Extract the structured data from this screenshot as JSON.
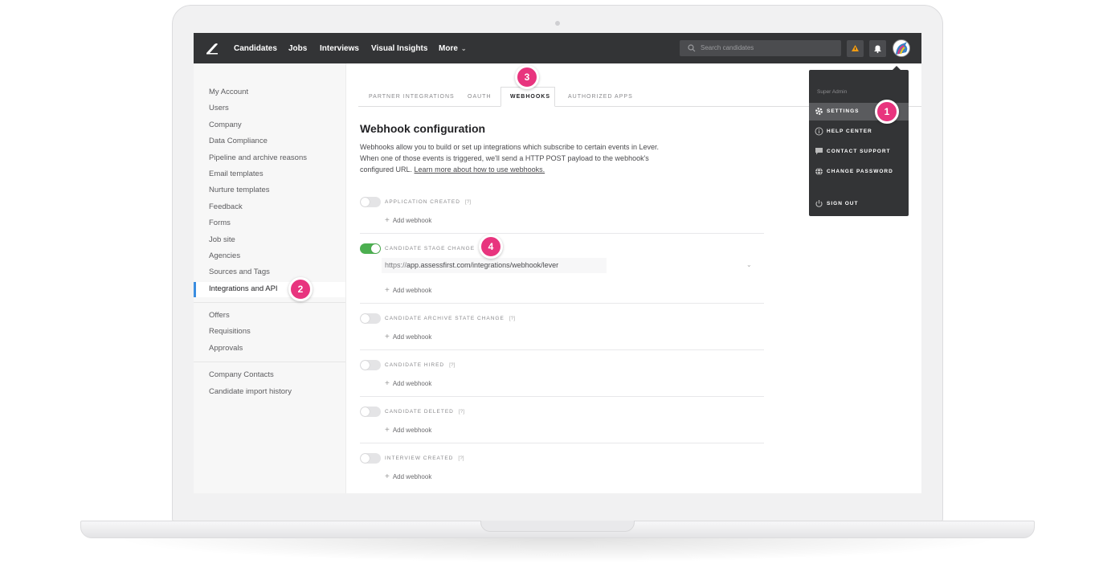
{
  "topbar": {
    "nav": [
      "Candidates",
      "Jobs",
      "Interviews",
      "Visual Insights",
      "More"
    ],
    "search_placeholder": "Search candidates"
  },
  "sidebar": {
    "group1": [
      "My Account",
      "Users",
      "Company",
      "Data Compliance",
      "Pipeline and archive reasons",
      "Email templates",
      "Nurture templates",
      "Feedback",
      "Forms",
      "Job site",
      "Agencies",
      "Sources and Tags",
      "Integrations and API"
    ],
    "group2": [
      "Offers",
      "Requisitions",
      "Approvals"
    ],
    "group3": [
      "Company Contacts",
      "Candidate import history"
    ]
  },
  "tabs": [
    "PARTNER INTEGRATIONS",
    "OAUTH",
    "WEBHOOKS",
    "AUTHORIZED APPS"
  ],
  "main": {
    "title": "Webhook configuration",
    "desc_text": "Webhooks allow you to build or set up integrations which subscribe to certain events in Lever. When one of those events is triggered, we'll send a HTTP POST payload to the webhook's configured URL. ",
    "desc_link": "Learn more about how to use webhooks.",
    "help_marker": "[?]",
    "add_label": "Add webhook",
    "url_prefix": "https://",
    "url_value": "app.assessfirst.com/integrations/webhook/lever",
    "events": [
      "APPLICATION CREATED",
      "CANDIDATE STAGE CHANGE",
      "CANDIDATE ARCHIVE STATE CHANGE",
      "CANDIDATE HIRED",
      "CANDIDATE DELETED",
      "INTERVIEW CREATED"
    ]
  },
  "dropdown": {
    "header": "Super Admin",
    "items": [
      "SETTINGS",
      "HELP CENTER",
      "CONTACT SUPPORT",
      "CHANGE PASSWORD",
      "SIGN OUT"
    ]
  },
  "badges": [
    "1",
    "2",
    "3",
    "4"
  ],
  "colors": {
    "accent": "#e8347e",
    "active_blue": "#3a8de0",
    "toggle_on": "#4caf50",
    "warning": "#f39c12"
  }
}
